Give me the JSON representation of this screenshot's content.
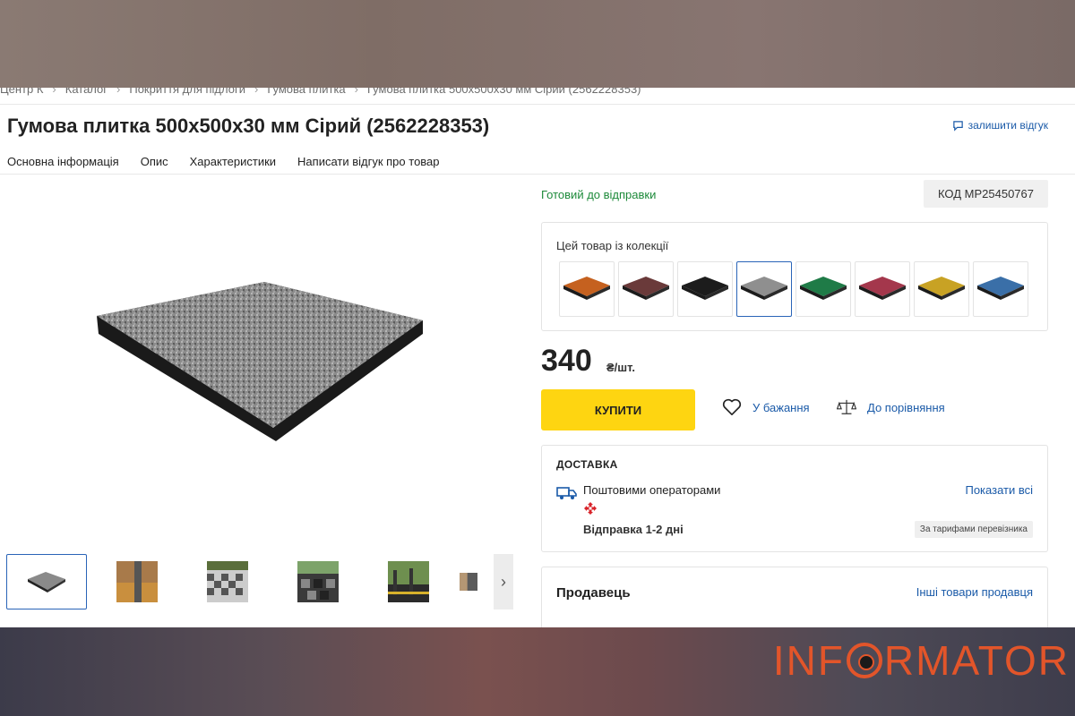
{
  "breadcrumb": [
    "Центр К",
    "Каталог",
    "Покриття для підлоги",
    "Гумова плитка",
    "Гумова плитка 500х500х30 мм Сірий (2562228353)"
  ],
  "product": {
    "title": "Гумова плитка 500х500х30 мм Сірий (2562228353)",
    "review_link": "залишити відгук",
    "status": "Готовий до відправки",
    "code": "КОД MP25450767",
    "price": "340",
    "price_unit": "₴/шт."
  },
  "tabs": [
    "Основна інформація",
    "Опис",
    "Характеристики",
    "Написати відгук про товар"
  ],
  "collection": {
    "label": "Цей товар із колекції",
    "colors": [
      "#c5611f",
      "#6a3a3a",
      "#1c1c1c",
      "#8f8f8f",
      "#1f7b47",
      "#a4374c",
      "#c8a224",
      "#3a6fa8"
    ],
    "selected_index": 3
  },
  "actions": {
    "buy": "КУПИТИ",
    "wishlist": "У бажання",
    "compare": "До порівняння"
  },
  "delivery": {
    "heading": "ДОСТАВКА",
    "method": "Поштовими операторами",
    "show_all": "Показати всі",
    "dispatch": "Відправка 1-2 дні",
    "tariff": "За тарифами перевізника"
  },
  "seller": {
    "heading": "Продавець",
    "other_items": "Інші товари продавця"
  },
  "watermark": "INFORMATOR",
  "colors": {
    "accent_yellow": "#fed511",
    "link_blue": "#1a5aa8",
    "status_green": "#1d8a3a",
    "logo_orange": "#e2552a"
  }
}
